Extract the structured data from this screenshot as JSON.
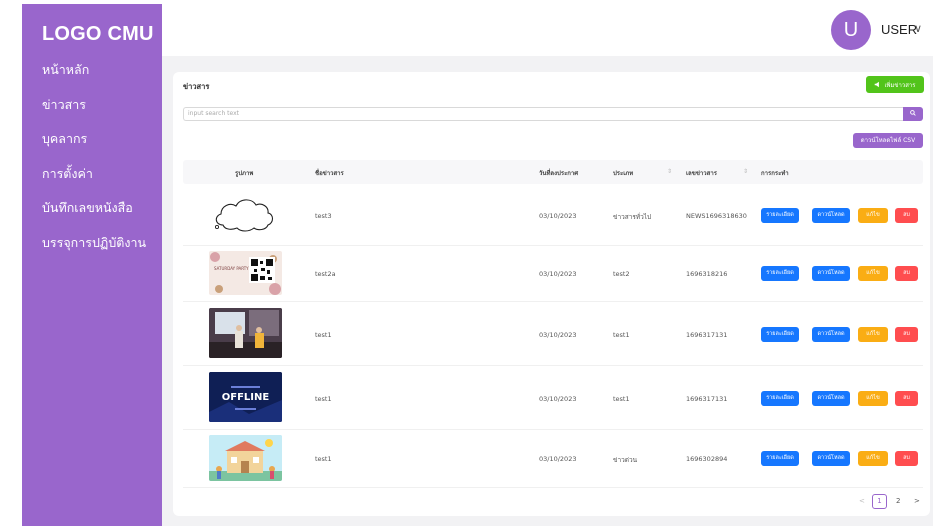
{
  "sidebar": {
    "logo": "LOGO CMU",
    "items": [
      {
        "label": "หน้าหลัก"
      },
      {
        "label": "ข่าวสาร"
      },
      {
        "label": "บุคลากร"
      },
      {
        "label": "การตั้งค่า"
      },
      {
        "label": "บันทึกเลขหนังสือ"
      },
      {
        "label": "บรรจุการปฏิบัติงาน"
      }
    ]
  },
  "header": {
    "avatar_letter": "U",
    "user_name": "USER",
    "caret": "∨"
  },
  "main": {
    "title": "ข่าวสาร",
    "add_button": "เพิ่มข่าวสาร",
    "search_placeholder": "input search text",
    "csv_button": "ดาวน์โหลดไฟล์ CSV",
    "columns": [
      "รูปภาพ",
      "ชื่อข่าวสาร",
      "วันที่ลงประกาศ",
      "ประเภท",
      "เลขข่าวสาร",
      "การกระทำ"
    ],
    "sort_glyph": "⇕",
    "actions": {
      "detail": "รายละเอียด",
      "print": "ดาวน์โหลด",
      "edit": "แก้ไข",
      "delete": "ลบ"
    },
    "rows": [
      {
        "name": "test3",
        "date": "03/10/2023",
        "type": "ข่าวสารทั่วไป",
        "number": "NEWS1696318630",
        "image": "cloud-sketch"
      },
      {
        "name": "test2a",
        "date": "03/10/2023",
        "type": "test2",
        "number": "1696318216",
        "image": "qr-poster"
      },
      {
        "name": "test1",
        "date": "03/10/2023",
        "type": "test1",
        "number": "1696317131",
        "image": "stage-photo"
      },
      {
        "name": "test1",
        "date": "03/10/2023",
        "type": "test1",
        "number": "1696317131",
        "image": "offline-banner"
      },
      {
        "name": "test1",
        "date": "03/10/2023",
        "type": "ข่าวด่วน",
        "number": "1696302894",
        "image": "building-illustration"
      }
    ],
    "offline_text": "OFFLINE",
    "poster_text": "SATURDAY PARTY",
    "pagination": {
      "prev": "<",
      "pages": [
        "1",
        "2"
      ],
      "current": "1",
      "next": ">"
    }
  },
  "colors": {
    "brand": "#9966cc",
    "primary": "#1677ff",
    "warning": "#faad14",
    "danger": "#ff4d4f",
    "success": "#52c41a"
  }
}
